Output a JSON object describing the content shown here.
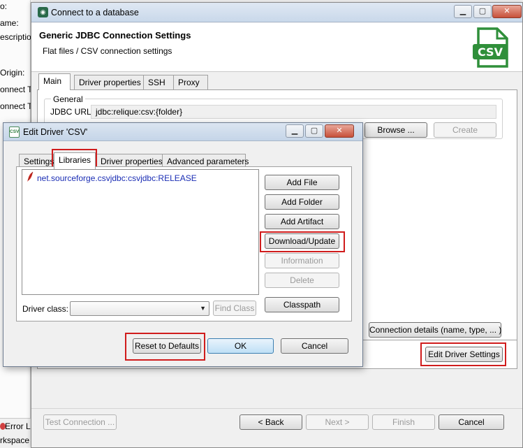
{
  "background": {
    "left_labels": [
      "o:",
      "ame:",
      "escription",
      "Origin:",
      "onnect T",
      "onnect T"
    ],
    "bottom_labels": [
      "Error Lo",
      "rkspace Log"
    ]
  },
  "main_dialog": {
    "title": "Connect to a database",
    "header_title": "Generic JDBC Connection Settings",
    "header_subtitle": "Flat files / CSV connection settings",
    "logo_text": "CSV",
    "tabs": [
      "Main",
      "Driver properties",
      "SSH",
      "Proxy"
    ],
    "active_tab": "Main",
    "general_group": "General",
    "jdbc_url_label": "JDBC URL:",
    "jdbc_url_value": "jdbc:relique:csv:{folder}",
    "browse_button": "Browse ...",
    "create_button": "Create",
    "connection_details_button": "Connection details (name, type, ... )",
    "edit_driver_settings_button": "Edit Driver Settings",
    "footer": {
      "test_connection": "Test Connection ...",
      "back": "< Back",
      "next": "Next >",
      "finish": "Finish",
      "cancel": "Cancel"
    }
  },
  "edit_driver_dialog": {
    "title": "Edit Driver 'CSV'",
    "tabs": [
      "Settings",
      "Libraries",
      "Driver properties",
      "Advanced parameters"
    ],
    "active_tab": "Libraries",
    "libraries": [
      {
        "name": "net.sourceforge.csvjdbc:csvjdbc:RELEASE",
        "icon": "maven-feather-icon"
      }
    ],
    "buttons": {
      "add_file": "Add File",
      "add_folder": "Add Folder",
      "add_artifact": "Add Artifact",
      "download_update": "Download/Update",
      "information": "Information",
      "delete": "Delete",
      "classpath": "Classpath"
    },
    "driver_class_label": "Driver class:",
    "driver_class_value": "",
    "find_class_button": "Find Class",
    "reset_defaults_button": "Reset to Defaults",
    "ok_button": "OK",
    "cancel_button": "Cancel"
  },
  "colors": {
    "highlight_box": "#d01c1c",
    "library_text": "#1a2db4",
    "logo_green": "#2f8f3a"
  }
}
